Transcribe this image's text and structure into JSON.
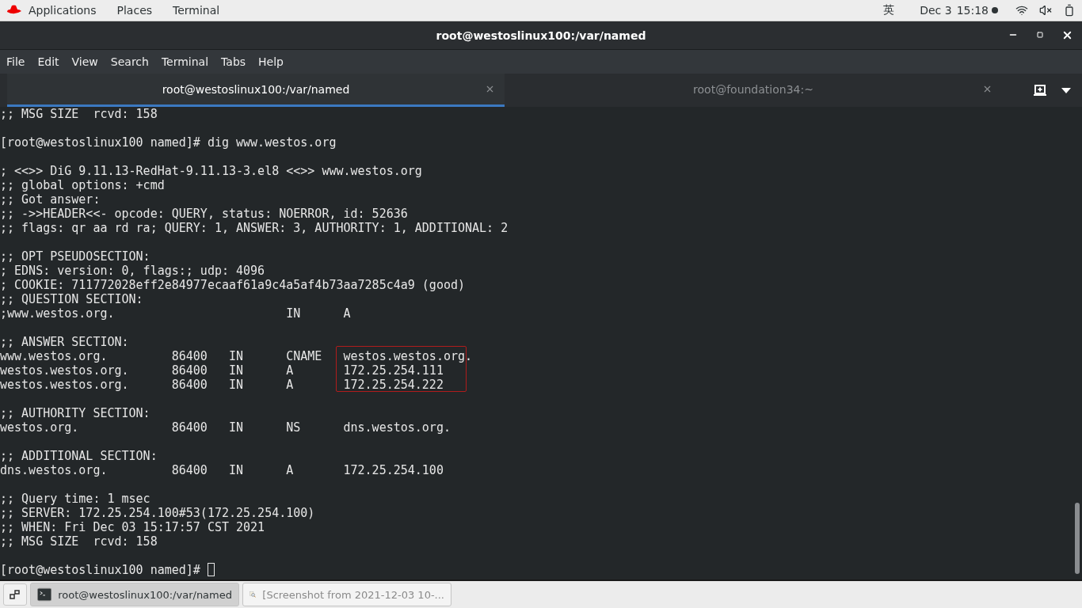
{
  "top_bar": {
    "menus": [
      "Applications",
      "Places",
      "Terminal"
    ],
    "input_method": "英",
    "date": "Dec 3",
    "time": "15:18"
  },
  "window": {
    "title": "root@westoslinux100:/var/named"
  },
  "menu_bar": [
    "File",
    "Edit",
    "View",
    "Search",
    "Terminal",
    "Tabs",
    "Help"
  ],
  "tabs": [
    {
      "label": "root@westoslinux100:/var/named",
      "selected": true
    },
    {
      "label": "root@foundation34:~",
      "selected": false
    }
  ],
  "terminal": {
    "lines": [
      {
        "kind": "text",
        "text": ";; MSG SIZE  rcvd: 158"
      },
      {
        "kind": "blank"
      },
      {
        "kind": "text",
        "text": "[root@westoslinux100 named]# dig www.westos.org"
      },
      {
        "kind": "blank"
      },
      {
        "kind": "text",
        "text": "; <<>> DiG 9.11.13-RedHat-9.11.13-3.el8 <<>> www.westos.org"
      },
      {
        "kind": "text",
        "text": ";; global options: +cmd"
      },
      {
        "kind": "text",
        "text": ";; Got answer:"
      },
      {
        "kind": "text",
        "text": ";; ->>HEADER<<- opcode: QUERY, status: NOERROR, id: 52636"
      },
      {
        "kind": "text",
        "text": ";; flags: qr aa rd ra; QUERY: 1, ANSWER: 3, AUTHORITY: 1, ADDITIONAL: 2"
      },
      {
        "kind": "blank"
      },
      {
        "kind": "text",
        "text": ";; OPT PSEUDOSECTION:"
      },
      {
        "kind": "text",
        "text": "; EDNS: version: 0, flags:; udp: 4096"
      },
      {
        "kind": "text",
        "text": "; COOKIE: 711772028eff2e84977ecaaf61a9c4a5af4b73aa7285c4a9 (good)"
      },
      {
        "kind": "text",
        "text": ";; QUESTION SECTION:"
      },
      {
        "kind": "text",
        "text": ";www.westos.org.                        IN      A"
      },
      {
        "kind": "blank"
      },
      {
        "kind": "text",
        "text": ";; ANSWER SECTION:"
      },
      {
        "kind": "boxed",
        "text": "www.westos.org.         86400   IN      CNAME   ",
        "boxed": "westos.westos.org",
        "after": "."
      },
      {
        "kind": "boxed",
        "text": "westos.westos.org.      86400   IN      A       ",
        "boxed": "172.25.254.111"
      },
      {
        "kind": "boxed",
        "text": "westos.westos.org.      86400   IN      A       ",
        "boxed": "172.25.254.222"
      },
      {
        "kind": "blank"
      },
      {
        "kind": "text",
        "text": ";; AUTHORITY SECTION:"
      },
      {
        "kind": "text",
        "text": "westos.org.             86400   IN      NS      dns.westos.org."
      },
      {
        "kind": "blank"
      },
      {
        "kind": "text",
        "text": ";; ADDITIONAL SECTION:"
      },
      {
        "kind": "text",
        "text": "dns.westos.org.         86400   IN      A       172.25.254.100"
      },
      {
        "kind": "blank"
      },
      {
        "kind": "text",
        "text": ";; Query time: 1 msec"
      },
      {
        "kind": "text",
        "text": ";; SERVER: 172.25.254.100#53(172.25.254.100)"
      },
      {
        "kind": "text",
        "text": ";; WHEN: Fri Dec 03 15:17:57 CST 2021"
      },
      {
        "kind": "text",
        "text": ";; MSG SIZE  rcvd: 158"
      },
      {
        "kind": "blank"
      },
      {
        "kind": "prompt",
        "text": "[root@westoslinux100 named]# "
      }
    ]
  },
  "taskbar": {
    "tasks": [
      {
        "kind": "terminal",
        "label": "root@westoslinux100:/var/named",
        "selected": true
      },
      {
        "kind": "image-viewer",
        "label": "[Screenshot from 2021-12-03 10-...",
        "selected": false
      }
    ]
  }
}
